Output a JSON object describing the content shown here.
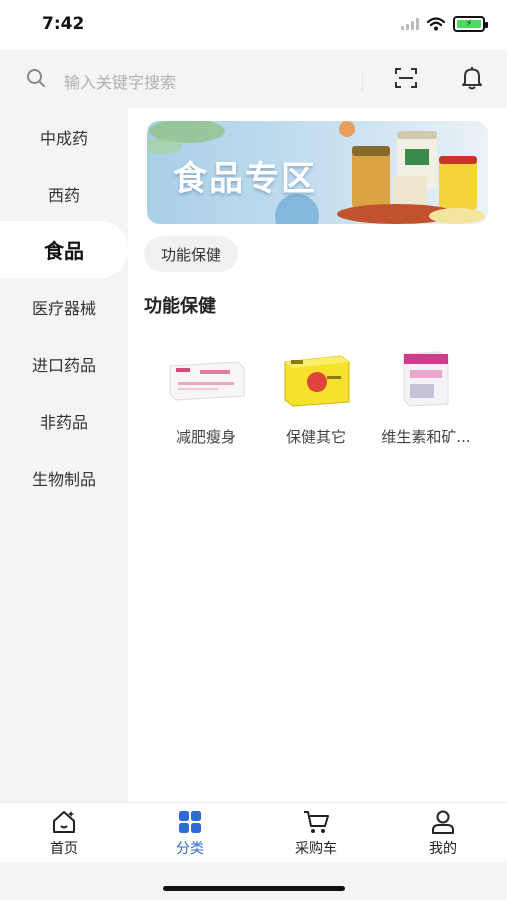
{
  "status_bar": {
    "time": "7:42",
    "battery_color": "#4cd964"
  },
  "search": {
    "placeholder": "输入关键字搜索",
    "icon": "search-icon",
    "scan_icon": "scan-icon",
    "bell_icon": "bell-icon"
  },
  "sidebar": {
    "items": [
      {
        "label": "中成药",
        "active": false
      },
      {
        "label": "西药",
        "active": false
      },
      {
        "label": "食品",
        "active": true
      },
      {
        "label": "医疗器械",
        "active": false
      },
      {
        "label": "进口药品",
        "active": false
      },
      {
        "label": "非药品",
        "active": false
      },
      {
        "label": "生物制品",
        "active": false
      }
    ]
  },
  "main": {
    "banner_title": "食品专区",
    "chip_label": "功能保健",
    "section_title": "功能保健",
    "products": [
      {
        "name": "减肥瘦身",
        "image": "medicine-box"
      },
      {
        "name": "保健其它",
        "image": "yellow-gift-box"
      },
      {
        "name": "维生素和矿...",
        "image": "vitamin-box"
      }
    ]
  },
  "tab_bar": {
    "active_color": "#2f6bd6",
    "tabs": [
      {
        "label": "首页",
        "icon": "home-icon",
        "active": false
      },
      {
        "label": "分类",
        "icon": "grid-icon",
        "active": true
      },
      {
        "label": "采购车",
        "icon": "cart-icon",
        "active": false
      },
      {
        "label": "我的",
        "icon": "user-icon",
        "active": false
      }
    ]
  }
}
